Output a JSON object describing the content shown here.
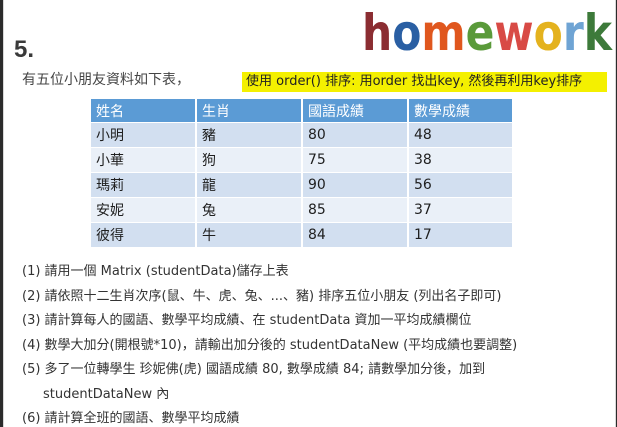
{
  "slide": {
    "number": "5.",
    "logo_text": "homework",
    "logo_colors": [
      "#8b2d32",
      "#2a5fa3",
      "#e0571e",
      "#5a9a3a",
      "#d84a45",
      "#e4b21e",
      "#6fa4d4",
      "#3d7a3a"
    ],
    "intro": "有五位小朋友資料如下表，",
    "highlight": "使用 order() 排序: 用order 找出key, 然後再利用key排序"
  },
  "table": {
    "headers": [
      "姓名",
      "生肖",
      "國語成績",
      "數學成績"
    ],
    "rows": [
      [
        "小明",
        "豬",
        "80",
        "48"
      ],
      [
        "小華",
        "狗",
        "75",
        "38"
      ],
      [
        "瑪莉",
        "龍",
        "90",
        "56"
      ],
      [
        "安妮",
        "兔",
        "85",
        "37"
      ],
      [
        "彼得",
        "牛",
        "84",
        "17"
      ]
    ]
  },
  "tasks": [
    "(1) 請用一個 Matrix (studentData)儲存上表",
    "(2) 請依照十二生肖次序(鼠、牛、虎、兔、...、豬) 排序五位小朋友 (列出名子即可)",
    "(3) 請計算每人的國語、數學平均成績、在 studentData 資加一平均成績欄位",
    "(4) 數學大加分(開根號*10)，請輸出加分後的 studentDataNew (平均成績也要調整)",
    "(5) 多了一位轉學生  珍妮佛(虎)  國語成績 80, 數學成績 84; 請數學加分後，加到",
    "studentDataNew 內",
    "(6) 請計算全班的國語、數學平均成績"
  ]
}
